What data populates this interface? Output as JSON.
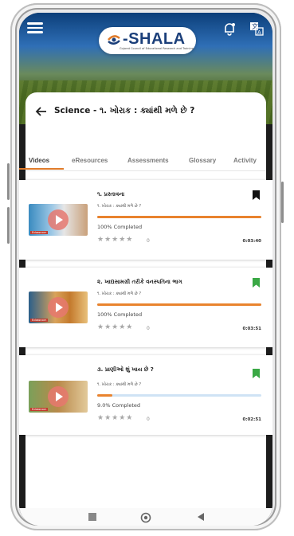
{
  "header": {
    "brand": "-SHALA",
    "tagline": "Gujarat Council of Educational Research and Training",
    "icons": [
      "menu-icon",
      "bell-icon",
      "translate-icon"
    ]
  },
  "page": {
    "title": "Science - ૧. ખોરાક : ક્યાંથી મળે છે ?"
  },
  "tabs": [
    {
      "label": "Videos",
      "active": true
    },
    {
      "label": "eResources",
      "active": false
    },
    {
      "label": "Assessments",
      "active": false
    },
    {
      "label": "Glossary",
      "active": false
    },
    {
      "label": "Activity",
      "active": false
    }
  ],
  "videos": [
    {
      "title": "૧. પ્રસ્તાવના",
      "subtitle": "૧. ખોરાક : ક્યાંથી મળે છે ?",
      "progress": 1.0,
      "status": "100% Completed",
      "rating": "0",
      "duration": "0:03:40",
      "bookmark_color": "#111111",
      "thumb_brand": "Eclassroom"
    },
    {
      "title": "૨. ખાદ્યસામગ્રી તરીકે વનસ્પતિના ભાગ",
      "subtitle": "૧. ખોરાક : ક્યાંથી મળે છે ?",
      "progress": 1.0,
      "status": "100% Completed",
      "rating": "0",
      "duration": "0:03:51",
      "bookmark_color": "#3aa845",
      "thumb_brand": "Eclassroom"
    },
    {
      "title": "૩. પ્રાણીઓ શું ખાય છે ?",
      "subtitle": "૧. ખોરાક : ક્યાંથી મળે છે ?",
      "progress": 0.09,
      "status": "9.0% Completed",
      "rating": "0",
      "duration": "0:02:51",
      "bookmark_color": "#3aa845",
      "thumb_brand": "Eclassroom"
    }
  ],
  "stars_glyph": "★★★★★",
  "colors": {
    "accent": "#e9832e",
    "brand": "#1b3f7a"
  }
}
